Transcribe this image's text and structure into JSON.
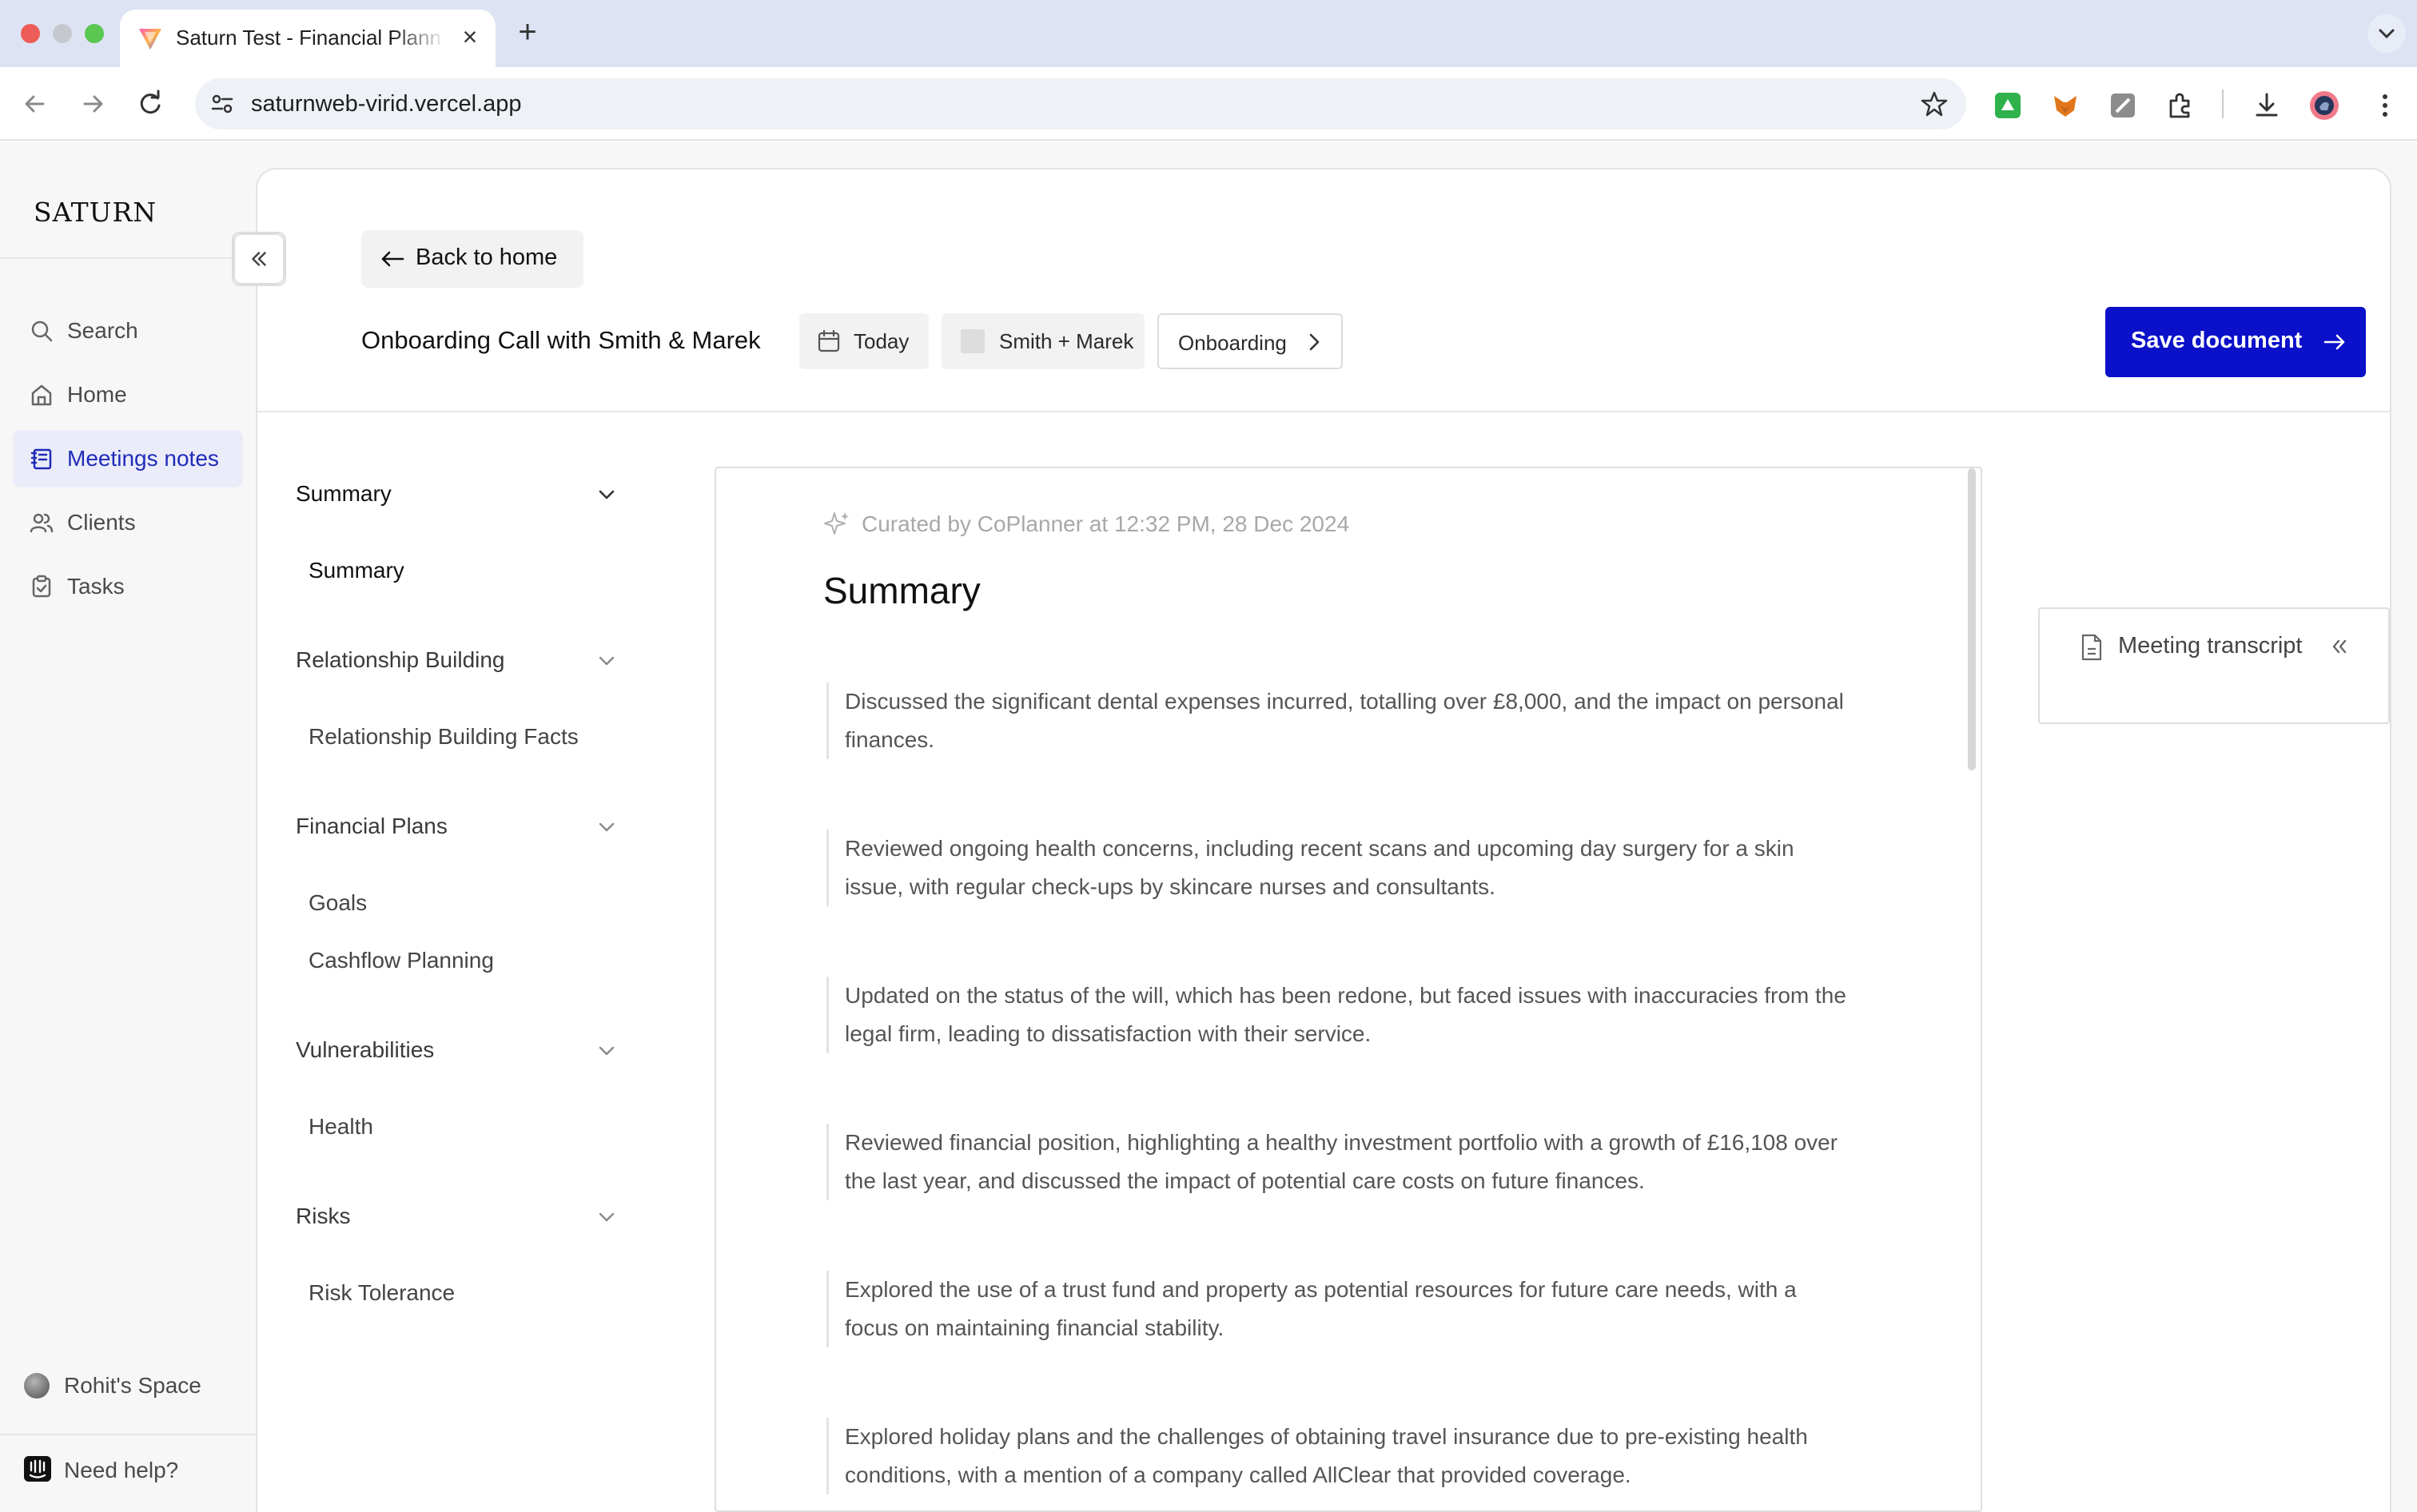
{
  "browser": {
    "tab_title": "Saturn Test - Financial Planning",
    "url": "saturnweb-virid.vercel.app",
    "icons": [
      "back-icon",
      "forward-icon",
      "reload-icon",
      "site-settings-icon",
      "bookmark-star-icon",
      "extension-icon",
      "download-icon",
      "profile-icon",
      "more-icon"
    ]
  },
  "sidebar": {
    "brand": "SATURN",
    "items": [
      {
        "label": "Search",
        "icon": "search-icon",
        "active": false
      },
      {
        "label": "Home",
        "icon": "home-icon",
        "active": false
      },
      {
        "label": "Meetings notes",
        "icon": "notes-icon",
        "active": true
      },
      {
        "label": "Clients",
        "icon": "clients-icon",
        "active": false
      },
      {
        "label": "Tasks",
        "icon": "tasks-icon",
        "active": false
      }
    ],
    "space_label": "Rohit's Space",
    "help_label": "Need help?"
  },
  "header": {
    "back_label": "Back to home",
    "title": "Onboarding Call with Smith & Marek",
    "date_chip": "Today",
    "client_chip": "Smith + Marek",
    "type_chip": "Onboarding",
    "save_label": "Save document",
    "accent_color": "#0b10c9"
  },
  "toc": {
    "sections": [
      {
        "title": "Summary",
        "items": [
          "Summary"
        ]
      },
      {
        "title": "Relationship Building",
        "items": [
          "Relationship Building Facts"
        ]
      },
      {
        "title": "Financial Plans",
        "items": [
          "Goals",
          "Cashflow Planning"
        ]
      },
      {
        "title": "Vulnerabilities",
        "items": [
          "Health"
        ]
      },
      {
        "title": "Risks",
        "items": [
          "Risk Tolerance"
        ]
      }
    ]
  },
  "document": {
    "curated": "Curated by CoPlanner at 12:32 PM, 28 Dec 2024",
    "heading": "Summary",
    "bullets": [
      "Discussed the significant dental expenses incurred, totalling over £8,000, and the impact on personal finances.",
      "Reviewed ongoing health concerns, including recent scans and upcoming day surgery for a skin issue, with regular check-ups by skincare nurses and consultants.",
      "Updated on the status of the will, which has been redone, but faced issues with inaccuracies from the legal firm, leading to dissatisfaction with their service.",
      "Reviewed financial position, highlighting a healthy investment portfolio with a growth of £16,108 over the last year, and discussed the impact of potential care costs on future finances.",
      "Explored the use of a trust fund and property as potential resources for future care needs, with a focus on maintaining financial stability.",
      "Explored holiday plans and the challenges of obtaining travel insurance due to pre-existing health conditions, with a mention of a company called AllClear that provided coverage."
    ]
  },
  "transcript": {
    "label": "Meeting transcript"
  }
}
